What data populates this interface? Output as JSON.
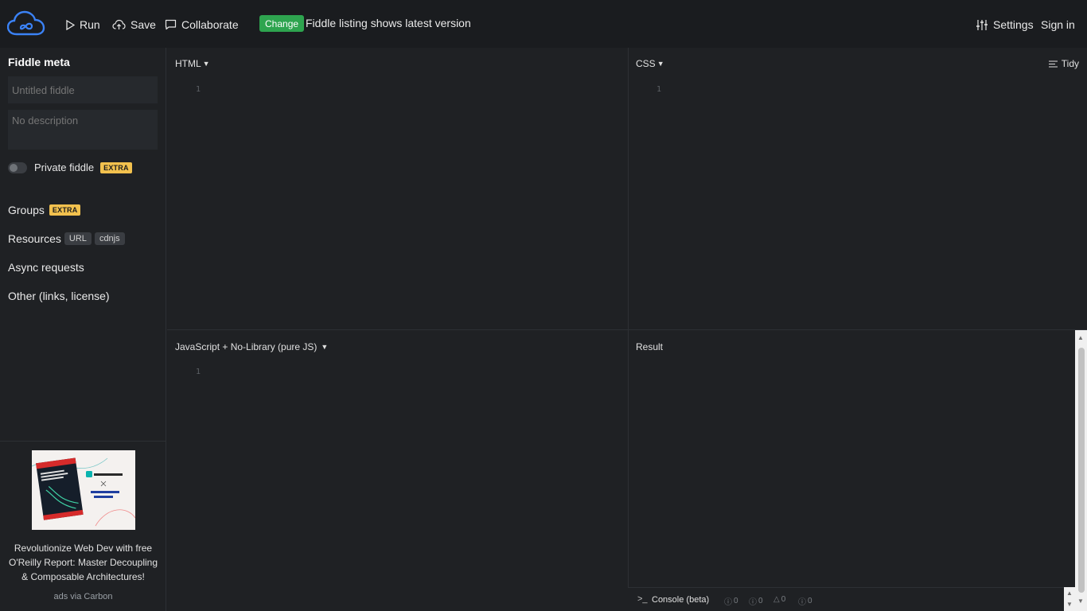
{
  "header": {
    "run_label": "Run",
    "save_label": "Save",
    "collaborate_label": "Collaborate",
    "change_badge": "Change",
    "change_text": "Fiddle listing shows latest version",
    "settings_label": "Settings",
    "signin_label": "Sign in"
  },
  "sidebar": {
    "meta_title": "Fiddle meta",
    "title_placeholder": "Untitled fiddle",
    "description_placeholder": "No description",
    "private_label": "Private fiddle",
    "extra_badge": "EXTRA",
    "groups_label": "Groups",
    "resources_label": "Resources",
    "url_chip": "URL",
    "cdnjs_chip": "cdnjs",
    "async_label": "Async requests",
    "other_label": "Other (links, license)",
    "ad_text": "Revolutionize Web Dev with free O'Reilly Report: Master Decoupling & Composable Architectures!",
    "ad_via": "ads via Carbon"
  },
  "panes": {
    "html_label": "HTML",
    "css_label": "CSS",
    "tidy_label": "Tidy",
    "js_label": "JavaScript + No-Library (pure JS)",
    "result_label": "Result",
    "line_number": "1"
  },
  "console": {
    "label": "Console (beta)",
    "prompt": ">_",
    "info_count": "0",
    "log_count": "0",
    "warn_count": "0",
    "error_count": "0"
  },
  "colors": {
    "background": "#1f2124",
    "header": "#1a1c1f",
    "accent_green": "#2ea44f",
    "extra_badge": "#f2c14e",
    "logo_blue": "#3b82f6"
  }
}
